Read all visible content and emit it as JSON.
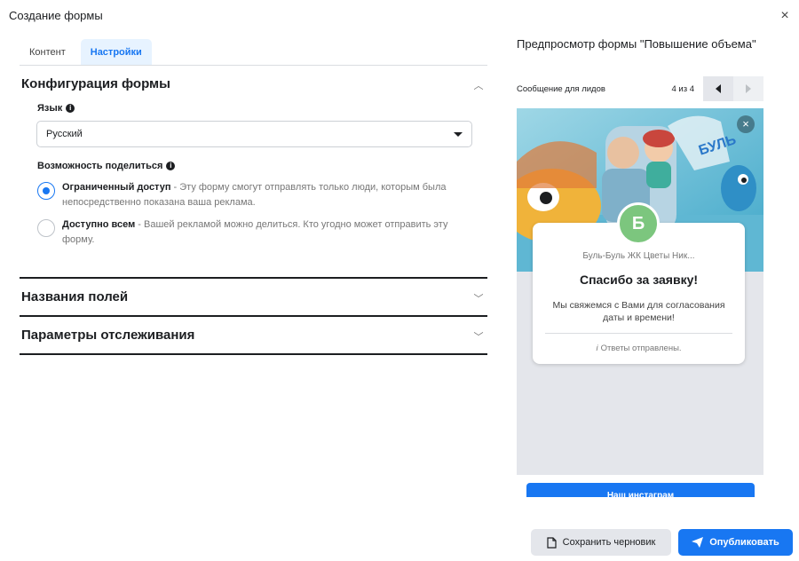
{
  "dialog": {
    "title": "Создание формы",
    "close_label": "×"
  },
  "tabs": [
    {
      "label": "Контент",
      "active": false
    },
    {
      "label": "Настройки",
      "active": true
    }
  ],
  "config": {
    "header": "Конфигурация формы",
    "language_label": "Язык",
    "language_value": "Русский",
    "sharing_label": "Возможность поделиться",
    "options": [
      {
        "title": "Ограниченный доступ",
        "text": " - Эту форму смогут отправлять только люди, которым была непосредственно показана ваша реклама.",
        "selected": true
      },
      {
        "title": "Доступно всем",
        "text": " - Вашей рекламой можно делиться. Кто угодно может отправить эту форму.",
        "selected": false
      }
    ]
  },
  "sections": {
    "field_names": "Названия полей",
    "tracking": "Параметры отслеживания"
  },
  "preview": {
    "title": "Предпросмотр формы \"Повышение объема\"",
    "message_label": "Сообщение для лидов",
    "counter": "4 из 4",
    "hero_text": "БУЛЬ",
    "avatar_letter": "Б",
    "page_name": "Буль-Буль ЖК Цветы Ник...",
    "thanks": "Спасибо за заявку!",
    "description": "Мы свяжемся с Вами для согласования даты и времени!",
    "sent_note": "Ответы отправлены.",
    "cta_label": "Наш инстаграм"
  },
  "footer": {
    "save_draft": "Сохранить черновик",
    "publish": "Опубликовать"
  },
  "colors": {
    "accent": "#1877f2",
    "avatar": "#7cc67e",
    "tab_active_bg": "#e7f3ff"
  }
}
